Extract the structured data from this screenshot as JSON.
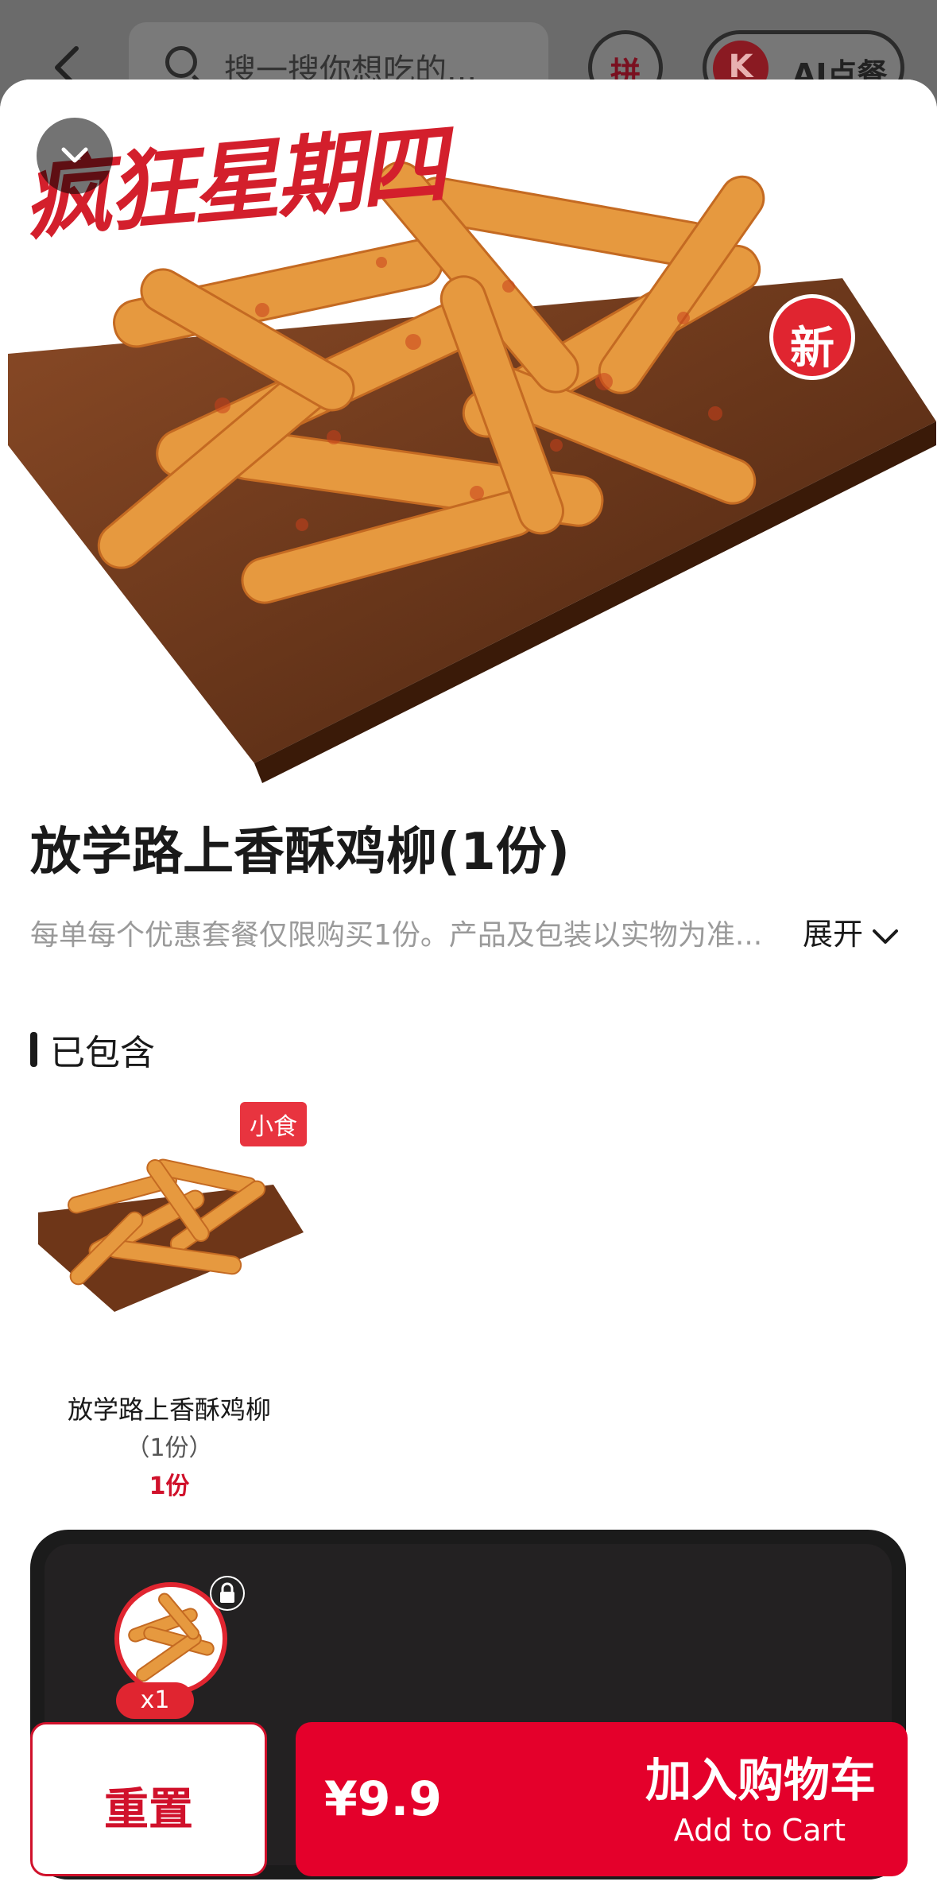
{
  "topbar": {
    "search_placeholder": "搜一搜你想吃的...",
    "pin_label": "拼",
    "ai_label": "AI点餐"
  },
  "hero": {
    "promo_text": "疯狂星期四",
    "new_badge": "新"
  },
  "product": {
    "title": "放学路上香酥鸡柳(1份)",
    "description": "每单每个优惠套餐仅限购买1份。产品及包装以实物为准...",
    "expand_label": "展开"
  },
  "included": {
    "heading": "已包含",
    "items": [
      {
        "tag": "小食",
        "name": "放学路上香酥鸡柳",
        "qty_text": "（1份）",
        "count_text": "1份"
      }
    ]
  },
  "cart": {
    "item_count_badge": "x1",
    "reset_label": "重置",
    "price": "¥9.9",
    "add_label_cn": "加入购物车",
    "add_label_en": "Add to Cart"
  },
  "colors": {
    "brand_red": "#e4002b",
    "promo_red": "#d31f2c",
    "badge_red": "#e8343f"
  }
}
